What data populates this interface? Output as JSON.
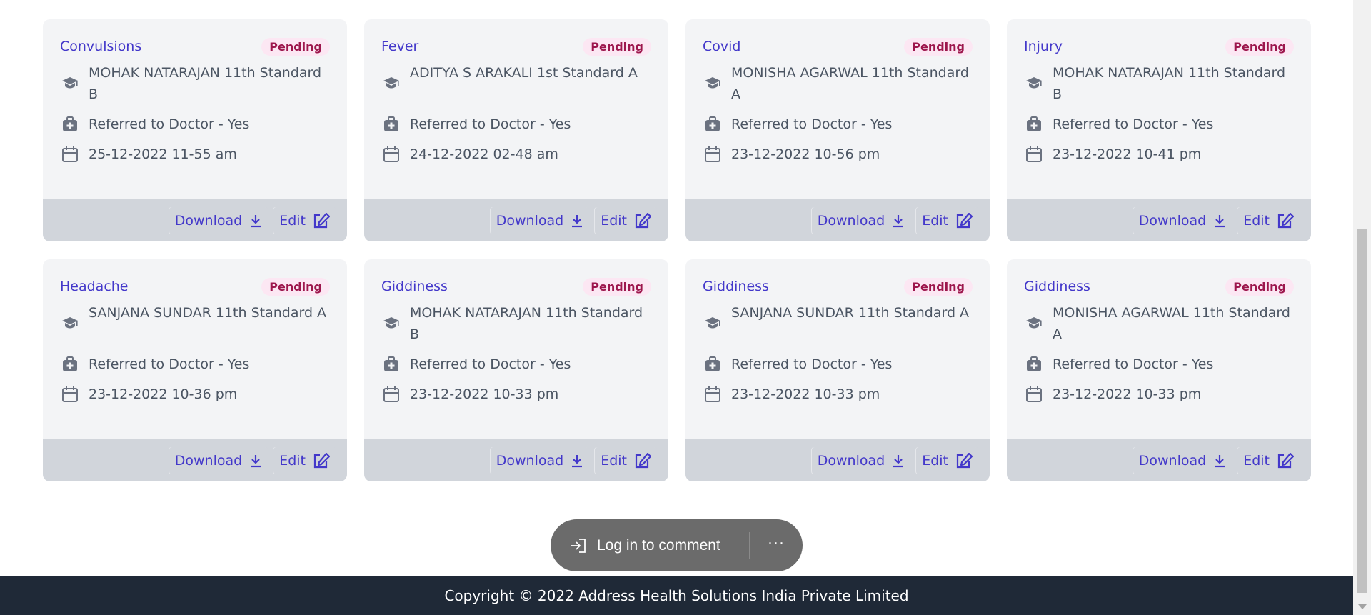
{
  "cards": [
    {
      "title": "Convulsions",
      "status": "Pending",
      "student": "MOHAK NATARAJAN 11th Standard B",
      "referred": "Referred to Doctor - Yes",
      "datetime": "25-12-2022 11-55 am",
      "download": "Download",
      "edit": "Edit"
    },
    {
      "title": "Fever",
      "status": "Pending",
      "student": "ADITYA S ARAKALI 1st Standard A",
      "referred": "Referred to Doctor - Yes",
      "datetime": "24-12-2022 02-48 am",
      "download": "Download",
      "edit": "Edit"
    },
    {
      "title": "Covid",
      "status": "Pending",
      "student": "MONISHA AGARWAL 11th Standard A",
      "referred": "Referred to Doctor - Yes",
      "datetime": "23-12-2022 10-56 pm",
      "download": "Download",
      "edit": "Edit"
    },
    {
      "title": "Injury",
      "status": "Pending",
      "student": "MOHAK NATARAJAN 11th Standard B",
      "referred": "Referred to Doctor - Yes",
      "datetime": "23-12-2022 10-41 pm",
      "download": "Download",
      "edit": "Edit"
    },
    {
      "title": "Headache",
      "status": "Pending",
      "student": "SANJANA SUNDAR 11th Standard A",
      "referred": "Referred to Doctor - Yes",
      "datetime": "23-12-2022 10-36 pm",
      "download": "Download",
      "edit": "Edit"
    },
    {
      "title": "Giddiness",
      "status": "Pending",
      "student": "MOHAK NATARAJAN 11th Standard B",
      "referred": "Referred to Doctor - Yes",
      "datetime": "23-12-2022 10-33 pm",
      "download": "Download",
      "edit": "Edit"
    },
    {
      "title": "Giddiness",
      "status": "Pending",
      "student": "SANJANA SUNDAR 11th Standard A",
      "referred": "Referred to Doctor - Yes",
      "datetime": "23-12-2022 10-33 pm",
      "download": "Download",
      "edit": "Edit"
    },
    {
      "title": "Giddiness",
      "status": "Pending",
      "student": "MONISHA AGARWAL 11th Standard A",
      "referred": "Referred to Doctor - Yes",
      "datetime": "23-12-2022 10-33 pm",
      "download": "Download",
      "edit": "Edit"
    }
  ],
  "toast": {
    "login_label": "Log in to comment",
    "more_label": "···"
  },
  "footer": {
    "copyright": "Copyright © 2022 Address Health Solutions India Private Limited"
  },
  "icons": {
    "student": "graduation-cap-icon",
    "referred": "medical-kit-icon",
    "date": "calendar-icon",
    "download": "download-icon",
    "edit": "edit-icon",
    "login": "login-icon"
  },
  "colors": {
    "accent": "#4338ca",
    "badge_bg": "#fce7f3",
    "badge_text": "#9d174d",
    "card_bg": "#f3f4f6",
    "footer_bg": "#1f2937"
  }
}
